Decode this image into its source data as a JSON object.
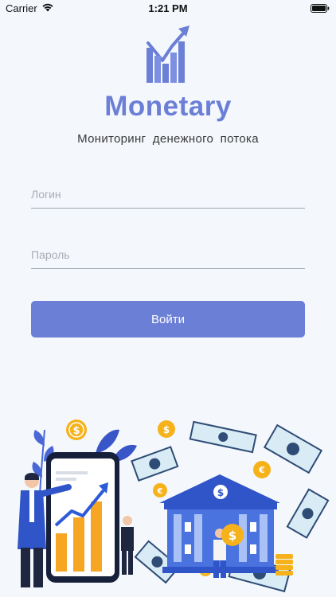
{
  "status_bar": {
    "carrier": "Carrier",
    "time": "1:21 PM"
  },
  "app": {
    "name": "Monetary",
    "tagline": "Мониторинг денежного потока",
    "accent_color": "#6b7fd7"
  },
  "form": {
    "login_placeholder": "Логин",
    "password_placeholder": "Пароль",
    "submit_label": "Войти"
  },
  "illustration": {
    "icons": [
      "dollar-coin-icon",
      "euro-coin-icon",
      "banknote-icon",
      "bank-building-icon",
      "growth-chart-icon"
    ]
  }
}
